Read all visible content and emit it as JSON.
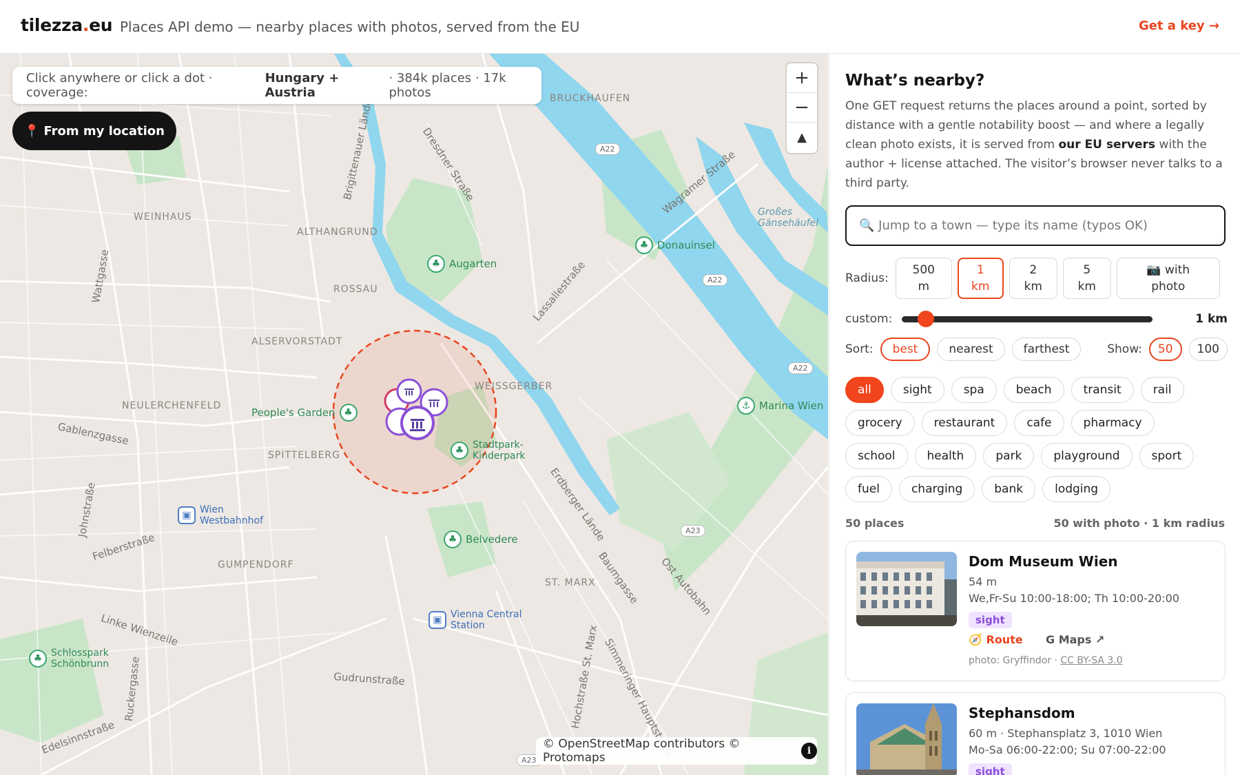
{
  "header": {
    "brand_main": "tilezza",
    "brand_dot": ".",
    "brand_tld": "eu",
    "tagline": "Places API demo — nearby places with photos, served from the EU",
    "get_key": "Get a key →"
  },
  "map": {
    "coverage_prefix": "Click anywhere or click a dot · coverage:",
    "coverage_region": "Hungary + Austria",
    "coverage_suffix": "· 384k places · 17k photos",
    "from_location": "From my location",
    "from_location_icon": "📍",
    "zoom_in": "+",
    "zoom_out": "−",
    "reset_north": "▲",
    "attribution": "© OpenStreetMap contributors © Protomaps",
    "info": "i",
    "districts": [
      "BRUCKHAUFEN",
      "WEINHAUS",
      "ALTHANGRUND",
      "ROSSAU",
      "ALSERVORSTADT",
      "NEULERCHENFELD",
      "SPITTELBERG",
      "WEISSGERBER",
      "GUMPENDORF",
      "ST. MARX"
    ],
    "streets": [
      "Dresdner Straße",
      "Brigittenauer Lände",
      "Wattgasse",
      "Gablenzgasse",
      "Felberstraße",
      "Johnstraße",
      "Linke Wienzeile",
      "Ruckergasse",
      "Gudrunstraße",
      "Hochstraße St. Marx",
      "Simmeringer Hauptstraße",
      "Erdberger Lände",
      "Lassallestraße",
      "Wagramer Straße",
      "Ost Autobahn",
      "Baumgasse",
      "Edelsinnstraße"
    ],
    "pois": [
      "Augarten",
      "Donauinsel",
      "People's Garden",
      "Stadtpark-Kinderpark",
      "Belvedere",
      "Schlosspark Schönbrunn",
      "Wien Westbahnhof",
      "Vienna Central Station",
      "Marina Wien"
    ],
    "water_labels": [
      "Großes Gänsehäufel"
    ],
    "roads": [
      "A22",
      "A22",
      "A22",
      "A23",
      "A23"
    ],
    "colors": {
      "accent": "#e8451f",
      "park": "#c9e5c8",
      "water": "#8fd6ee"
    }
  },
  "panel": {
    "title": "What’s nearby?",
    "intro_1": "One GET request returns the places around a point, sorted by distance with a gentle notability boost — and where a legally clean photo exists, it is served from",
    "intro_bold": "our EU servers",
    "intro_2": "with the author + license attached. The visitor’s browser never talks to a third party.",
    "search_placeholder": "🔍 Jump to a town — type its name (typos OK)",
    "radius_label": "Radius:",
    "radius_options": [
      "500\nm",
      "1\nkm",
      "2\nkm",
      "5\nkm",
      "📷 with\nphoto"
    ],
    "radius_selected": 1,
    "custom_label": "custom:",
    "custom_value": "1 km",
    "custom_fraction": 0.08,
    "sort_label": "Sort:",
    "sort_options": [
      "best",
      "nearest",
      "farthest"
    ],
    "show_label": "Show:",
    "show_options": [
      "50",
      "100"
    ],
    "categories": [
      [
        "all",
        "sight",
        "spa",
        "beach",
        "transit",
        "rail"
      ],
      [
        "grocery",
        "restaurant",
        "cafe",
        "pharmacy"
      ],
      [
        "school",
        "health",
        "park",
        "playground",
        "sport"
      ],
      [
        "fuel",
        "charging",
        "bank",
        "lodging"
      ]
    ],
    "count_left": "50 places",
    "count_right": "50 with photo · 1 km radius",
    "results": [
      {
        "name": "Dom Museum Wien",
        "distance": "54 m",
        "hours": "We,Fr-Su 10:00-18:00; Th 10:00-20:00",
        "tag": "sight",
        "route": "🧭 Route",
        "gmaps": "G Maps ↗",
        "credit_prefix": "photo: Gryffindor ·",
        "license": "CC BY-SA 3.0"
      },
      {
        "name": "Stephansdom",
        "distance": "60 m · Stephansplatz 3, 1010 Wien",
        "hours": "Mo-Sa 06:00-22:00; Su 07:00-22:00",
        "tag": "sight"
      }
    ]
  }
}
